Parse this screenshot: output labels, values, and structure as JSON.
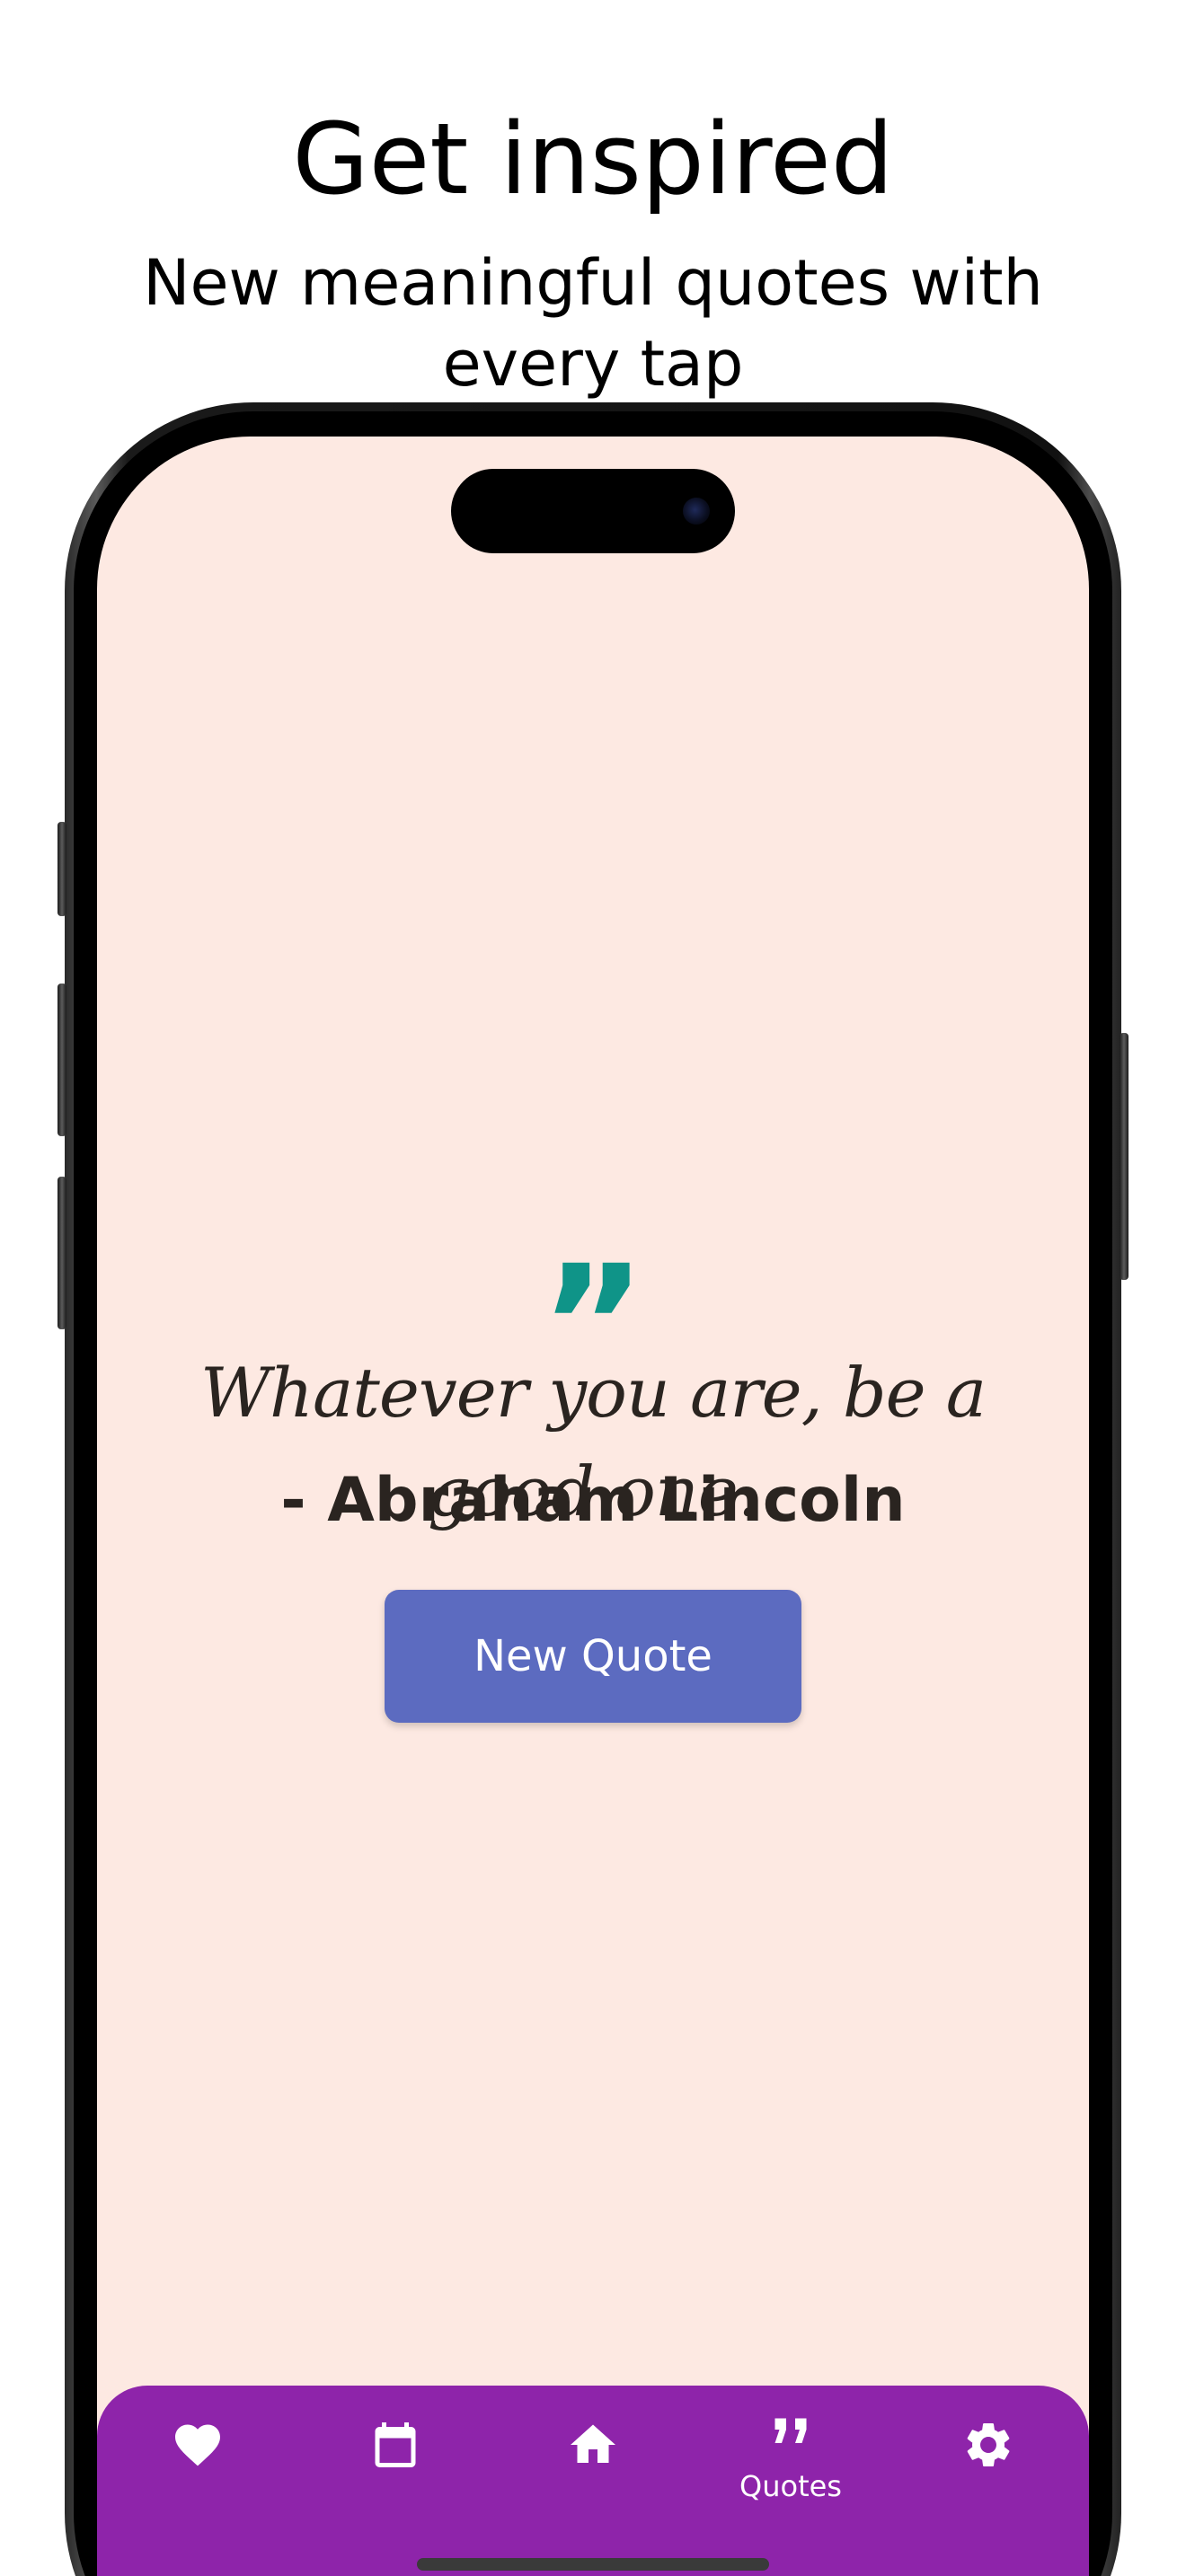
{
  "promo": {
    "title": "Get inspired",
    "subtitle": "New meaningful quotes with every tap"
  },
  "quote": {
    "mark": "”",
    "text": "Whatever you are, be a good one.",
    "author": "- Abraham Lincoln",
    "button_label": "New Quote"
  },
  "nav": {
    "items": [
      {
        "icon": "heart-icon",
        "label": ""
      },
      {
        "icon": "calendar-icon",
        "label": ""
      },
      {
        "icon": "home-icon",
        "label": ""
      },
      {
        "icon": "quote-icon",
        "label": "Quotes",
        "selected": true
      },
      {
        "icon": "gear-icon",
        "label": ""
      }
    ]
  },
  "colors": {
    "screen_background": "#fde9e2",
    "accent_teal": "#0f9488",
    "button_indigo": "#5c6bc0",
    "nav_purple": "#8e24aa"
  }
}
